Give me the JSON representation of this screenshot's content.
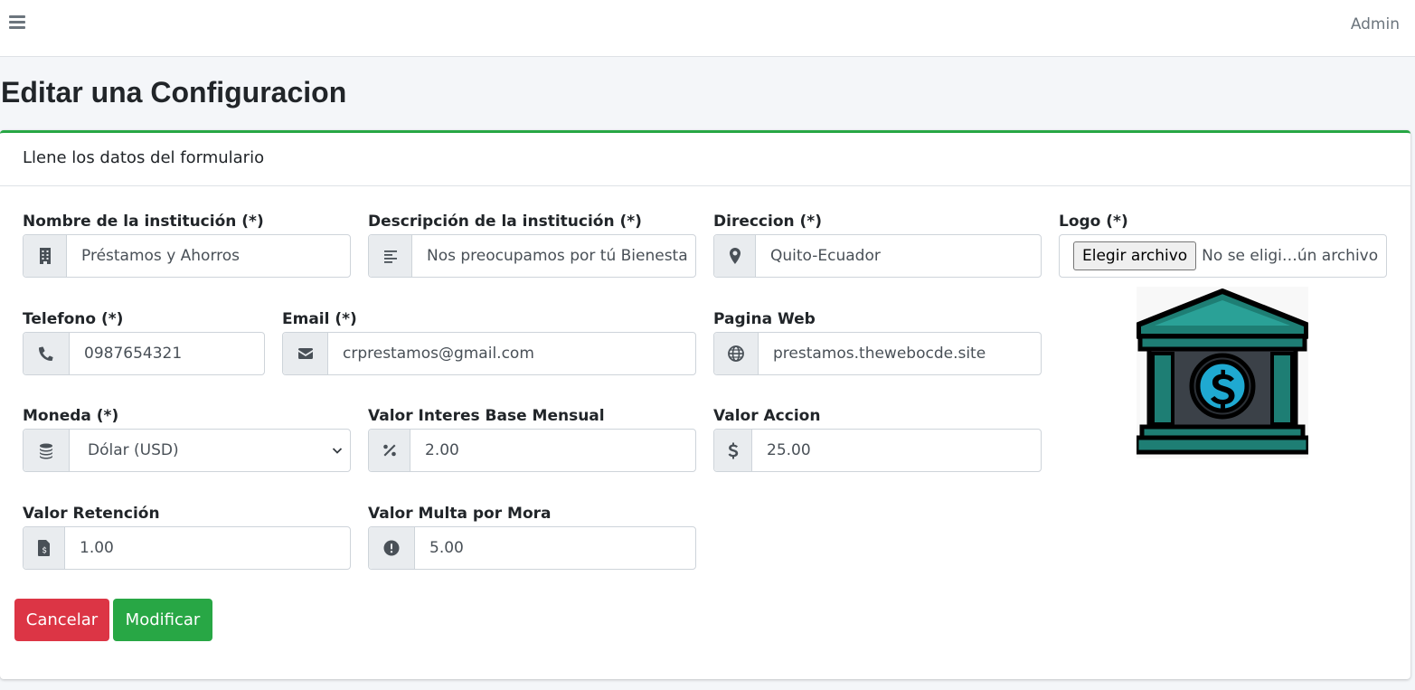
{
  "topbar": {
    "menu_icon": "hamburger-icon",
    "user_label": "Admin"
  },
  "page": {
    "title": "Editar una Configuracion"
  },
  "card": {
    "header": "Llene los datos del formulario",
    "accent_color": "#28a745"
  },
  "form": {
    "nombre": {
      "label": "Nombre de la institución (*)",
      "value": "Préstamos y Ahorros",
      "icon": "building-icon"
    },
    "descripcion": {
      "label": "Descripción de la institución (*)",
      "value": "Nos preocupamos por tú Bienesta",
      "icon": "align-left-icon"
    },
    "direccion": {
      "label": "Direccion (*)",
      "value": "Quito-Ecuador",
      "icon": "map-marker-icon"
    },
    "logo": {
      "label": "Logo (*)",
      "button_label": "Elegir archivo",
      "file_text": "No se eligi…ún archivo",
      "preview_icon": "bank-dollar-icon"
    },
    "telefono": {
      "label": "Telefono (*)",
      "value": "0987654321",
      "icon": "phone-icon"
    },
    "email": {
      "label": "Email (*)",
      "value": "crprestamos@gmail.com",
      "icon": "envelope-icon"
    },
    "web": {
      "label": "Pagina Web",
      "value": "prestamos.thewebocde.site",
      "icon": "globe-icon"
    },
    "moneda": {
      "label": "Moneda (*)",
      "value": "Dólar (USD)",
      "icon": "coins-icon"
    },
    "interes": {
      "label": "Valor Interes Base Mensual",
      "value": "2.00",
      "icon": "percent-icon"
    },
    "accion": {
      "label": "Valor Accion",
      "value": "25.00",
      "icon": "dollar-icon"
    },
    "retencion": {
      "label": "Valor Retención",
      "value": "1.00",
      "icon": "invoice-dollar-icon"
    },
    "multa": {
      "label": "Valor Multa por Mora",
      "value": "5.00",
      "icon": "exclamation-circle-icon"
    }
  },
  "actions": {
    "cancel_label": "Cancelar",
    "submit_label": "Modificar",
    "cancel_color": "#dc3545",
    "submit_color": "#28a745"
  }
}
